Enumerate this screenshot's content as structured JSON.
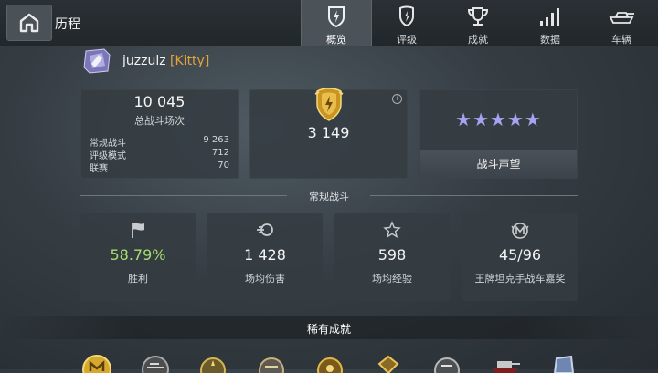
{
  "header": {
    "title": "历程",
    "tabs": [
      {
        "label": "概览",
        "icon": "shield-bolt-icon",
        "active": true
      },
      {
        "label": "评级",
        "icon": "rating-shield-icon",
        "active": false
      },
      {
        "label": "成就",
        "icon": "trophy-icon",
        "active": false
      },
      {
        "label": "数据",
        "icon": "bar-chart-icon",
        "active": false
      },
      {
        "label": "车辆",
        "icon": "tank-icon",
        "active": false
      }
    ]
  },
  "player": {
    "name": "juzzulz",
    "clan": "[Kitty]"
  },
  "battles": {
    "total": "10 045",
    "total_label": "总战斗场次",
    "rows": [
      {
        "label": "常规战斗",
        "value": "9 263"
      },
      {
        "label": "评级模式",
        "value": "712"
      },
      {
        "label": "联赛",
        "value": "70"
      }
    ]
  },
  "rating": {
    "value": "3 149",
    "info": "i"
  },
  "reputation": {
    "stars": "★★★★★",
    "star_count": 5,
    "button_label": "战斗声望"
  },
  "regular": {
    "title": "常规战斗",
    "stats": [
      {
        "icon": "flag-icon",
        "value": "58.79%",
        "label": "胜利"
      },
      {
        "icon": "damage-shell-icon",
        "value": "1 428",
        "label": "场均伤害"
      },
      {
        "icon": "star-outline-icon",
        "value": "598",
        "label": "场均经验"
      },
      {
        "icon": "mastery-badge-icon",
        "value": "45/96",
        "label": "王牌坦克手战车嘉奖"
      }
    ]
  },
  "rare": {
    "title": "稀有成就",
    "medals": [
      "mastery-m-medal",
      "tank-medal",
      "wreath-medal",
      "wreath-medal",
      "wreath-medal",
      "order-medal",
      "gold-tank-medal",
      "bomb-medal",
      "shield-medal"
    ]
  },
  "colors": {
    "accent_green": "#a7df6d",
    "clan_orange": "#e4a33a",
    "stars": "#a9a2f0",
    "gold": "#e6b43a"
  }
}
